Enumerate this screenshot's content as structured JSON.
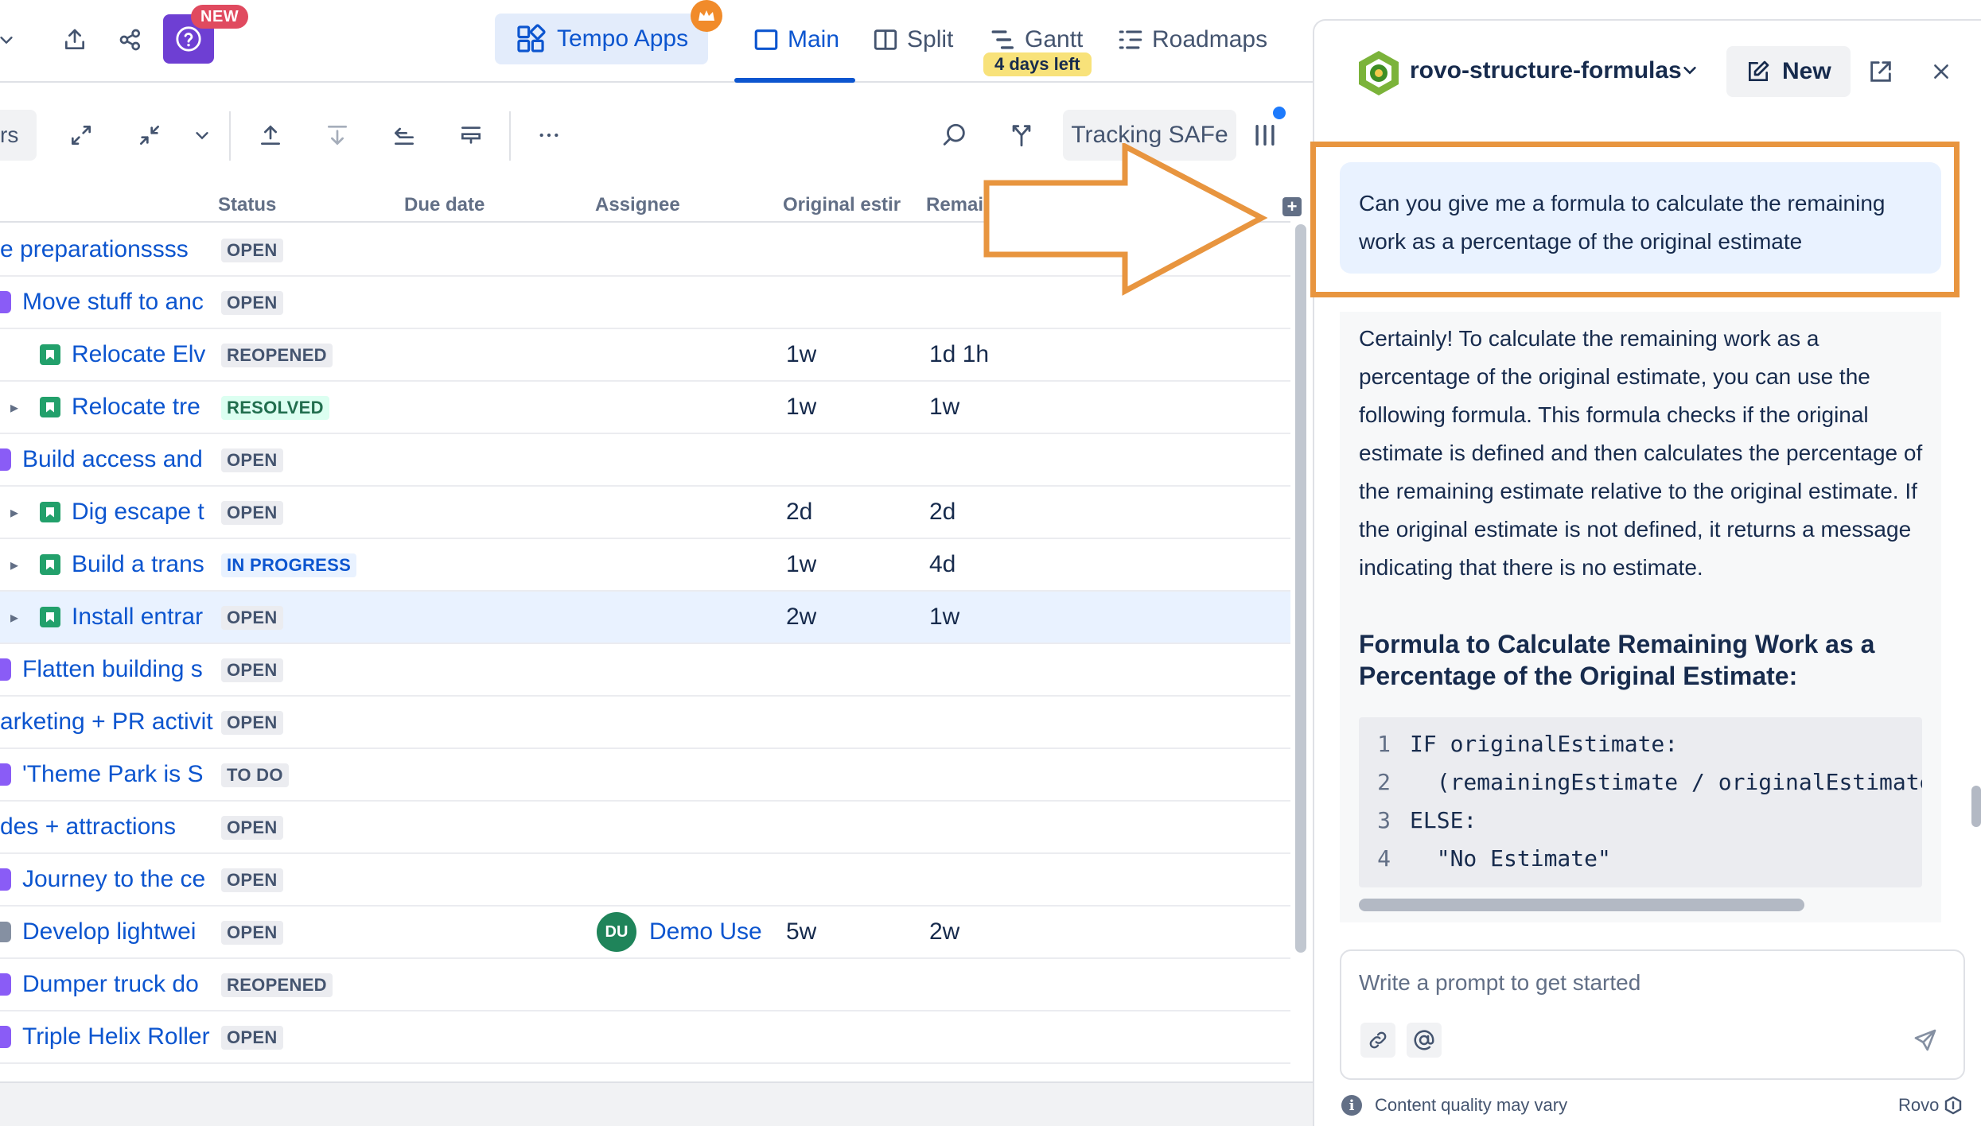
{
  "topbar": {
    "new_badge": "NEW",
    "tempo_label": "Tempo Apps",
    "tabs": [
      {
        "label": "Main"
      },
      {
        "label": "Split"
      },
      {
        "label": "Gantt"
      },
      {
        "label": "Roadmaps"
      }
    ],
    "gantt_badge": "4 days left"
  },
  "toolbar": {
    "left_cut_label": "rs",
    "tracking_label": "Tracking SAFe"
  },
  "grid": {
    "columns": {
      "status": "Status",
      "due": "Due date",
      "assignee": "Assignee",
      "original": "Original estir",
      "remaining": "Remai"
    },
    "rows": [
      {
        "summary": "e preparationssss",
        "icon": "none",
        "status": "OPEN",
        "orig": "",
        "rem": ""
      },
      {
        "summary": "Move stuff to anc",
        "icon": "epic",
        "status": "OPEN",
        "orig": "",
        "rem": ""
      },
      {
        "summary": "Relocate Elv",
        "icon": "story",
        "status": "REOPENED",
        "orig": "1w",
        "rem": "1d 1h"
      },
      {
        "summary": "Relocate tre",
        "icon": "story",
        "status": "RESOLVED",
        "orig": "1w",
        "rem": "1w"
      },
      {
        "summary": "Build access and",
        "icon": "epic",
        "status": "OPEN",
        "orig": "",
        "rem": ""
      },
      {
        "summary": "Dig escape t",
        "icon": "story",
        "status": "OPEN",
        "orig": "2d",
        "rem": "2d"
      },
      {
        "summary": "Build a trans",
        "icon": "story",
        "status": "IN PROGRESS",
        "orig": "1w",
        "rem": "4d"
      },
      {
        "summary": "Install entrar",
        "icon": "story",
        "status": "OPEN",
        "orig": "2w",
        "rem": "1w"
      },
      {
        "summary": "Flatten building s",
        "icon": "epic",
        "status": "OPEN",
        "orig": "",
        "rem": ""
      },
      {
        "summary": "arketing + PR activit",
        "icon": "none",
        "status": "OPEN",
        "orig": "",
        "rem": ""
      },
      {
        "summary": "'Theme Park is S",
        "icon": "epic",
        "status": "TO DO",
        "orig": "",
        "rem": ""
      },
      {
        "summary": "des + attractions",
        "icon": "none",
        "status": "OPEN",
        "orig": "",
        "rem": ""
      },
      {
        "summary": "Journey to the ce",
        "icon": "epic",
        "status": "OPEN",
        "orig": "",
        "rem": ""
      },
      {
        "summary": "Develop lightwei",
        "icon": "task",
        "status": "OPEN",
        "orig": "5w",
        "rem": "2w",
        "assignee": "Demo User",
        "initials": "DU"
      },
      {
        "summary": "Dumper truck do",
        "icon": "epic",
        "status": "REOPENED",
        "orig": "",
        "rem": ""
      },
      {
        "summary": "Triple Helix Roller",
        "icon": "epic",
        "status": "OPEN",
        "orig": "",
        "rem": ""
      }
    ]
  },
  "panel": {
    "title": "rovo-structure-formulas",
    "new_label": "New",
    "user_message": "Can you give me a formula to calculate the remaining work as a percentage of the original estimate",
    "assistant_text": "Certainly! To calculate the remaining work as a percentage of the original estimate, you can use the following formula. This formula checks if the original estimate is defined and then calculates the percentage of the remaining estimate relative to the original estimate. If the original estimate is not defined, it returns a message indicating that there is no estimate.",
    "heading": "Formula to Calculate Remaining Work as a Percentage of the Original Estimate:",
    "code": [
      {
        "n": "1",
        "text": "IF originalEstimate:"
      },
      {
        "n": "2",
        "text": "  (remainingEstimate / originalEstimate"
      },
      {
        "n": "3",
        "text": "ELSE:"
      },
      {
        "n": "4",
        "text": "  \"No Estimate\""
      }
    ],
    "input_placeholder": "Write a prompt to get started",
    "footer_note": "Content quality may vary",
    "brand": "Rovo"
  },
  "colors": {
    "accent": "#0c55cf",
    "highlight": "#e8953f",
    "help_purple": "#6e3fd3"
  }
}
